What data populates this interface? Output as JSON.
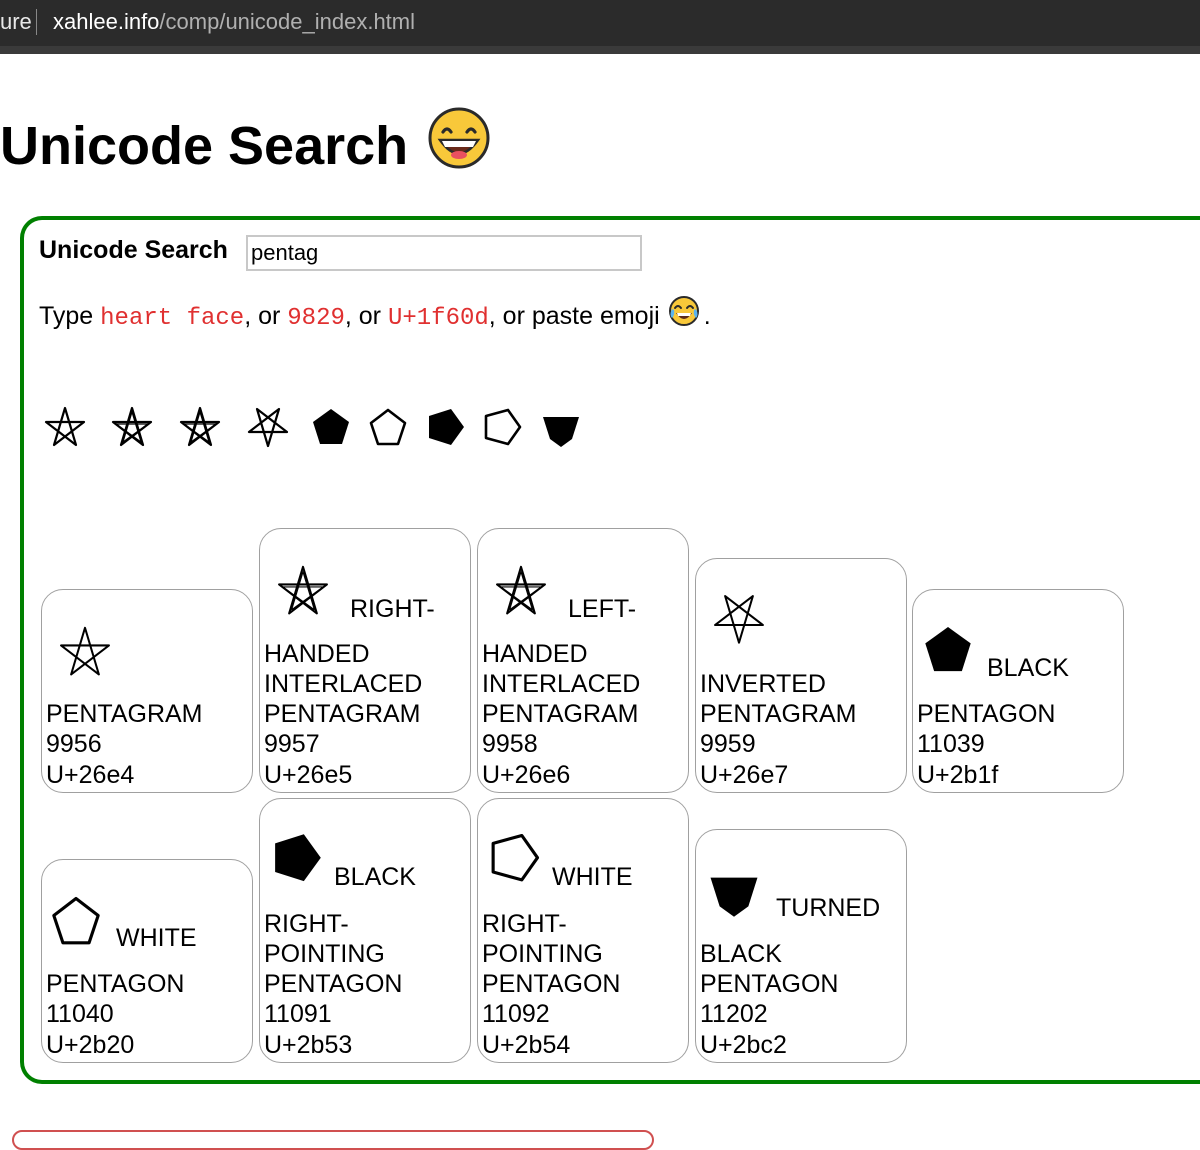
{
  "browser": {
    "url_prefix": "ure",
    "url_host": "xahlee.info",
    "url_path": "/comp/unicode_index.html"
  },
  "page": {
    "title": "Unicode Search",
    "title_emoji": "grinning-face-icon"
  },
  "search": {
    "label": "Unicode Search",
    "value": "pentag",
    "hint_type": "Type",
    "hint_code1": "heart face",
    "hint_or1": ", or",
    "hint_code2": "9829",
    "hint_or2": ", or",
    "hint_code3": "U+1f60d",
    "hint_tail": ", or paste emoji",
    "hint_end": "."
  },
  "glyphs": [
    {
      "char": "⛤",
      "icon": "pentagram-icon"
    },
    {
      "char": "⛥",
      "icon": "right-handed-interlaced-pentagram-icon"
    },
    {
      "char": "⛦",
      "icon": "left-handed-interlaced-pentagram-icon"
    },
    {
      "char": "⛧",
      "icon": "inverted-pentagram-icon"
    },
    {
      "char": "⬟",
      "icon": "black-pentagon-icon"
    },
    {
      "char": "⬠",
      "icon": "white-pentagon-icon"
    },
    {
      "char": "⭓",
      "icon": "black-right-pointing-pentagon-icon"
    },
    {
      "char": "⭔",
      "icon": "white-right-pointing-pentagon-icon"
    },
    {
      "char": "⯂",
      "icon": "turned-black-pentagon-icon"
    }
  ],
  "cards": [
    {
      "first": "",
      "rest": [
        "PENTAGRAM"
      ],
      "decimal": "9956",
      "codepoint": "U+26e4"
    },
    {
      "first": "RIGHT-",
      "rest": [
        "HANDED",
        "INTERLACED",
        "PENTAGRAM"
      ],
      "decimal": "9957",
      "codepoint": "U+26e5"
    },
    {
      "first": "LEFT-",
      "rest": [
        "HANDED",
        "INTERLACED",
        "PENTAGRAM"
      ],
      "decimal": "9958",
      "codepoint": "U+26e6"
    },
    {
      "first": "",
      "rest": [
        "INVERTED",
        "PENTAGRAM"
      ],
      "decimal": "9959",
      "codepoint": "U+26e7"
    },
    {
      "first": "BLACK",
      "rest": [
        "PENTAGON"
      ],
      "decimal": "11039",
      "codepoint": "U+2b1f"
    },
    {
      "first": "WHITE",
      "rest": [
        "PENTAGON"
      ],
      "decimal": "11040",
      "codepoint": "U+2b20"
    },
    {
      "first": "BLACK",
      "rest": [
        "RIGHT-",
        "POINTING",
        "PENTAGON"
      ],
      "decimal": "11091",
      "codepoint": "U+2b53"
    },
    {
      "first": "WHITE",
      "rest": [
        "RIGHT-",
        "POINTING",
        "PENTAGON"
      ],
      "decimal": "11092",
      "codepoint": "U+2b54"
    },
    {
      "first": "TURNED",
      "rest": [
        "BLACK",
        "PENTAGON"
      ],
      "decimal": "11202",
      "codepoint": "U+2bc2"
    }
  ],
  "colors": {
    "accent_border": "#008000",
    "code_red": "#e03030",
    "card_border": "#a0a0a0"
  }
}
